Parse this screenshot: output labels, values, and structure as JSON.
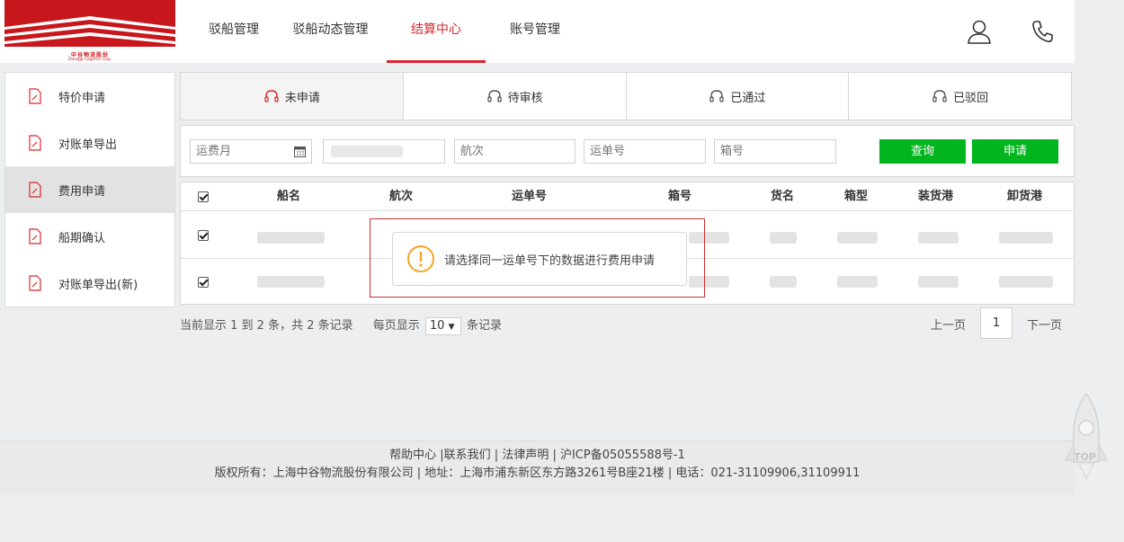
{
  "logo": {
    "text": "中谷物流股份",
    "sub": "Zhonggu Logistics Corp."
  },
  "nav": {
    "items": [
      "驳船管理",
      "驳船动态管理",
      "结算中心",
      "账号管理"
    ],
    "active_index": 2
  },
  "header_icons": [
    "user-icon",
    "phone-icon"
  ],
  "sidebar": {
    "items": [
      "特价申请",
      "对账单导出",
      "费用申请",
      "船期确认",
      "对账单导出(新)"
    ],
    "active_index": 2
  },
  "tabs": {
    "items": [
      "未申请",
      "待审核",
      "已通过",
      "已驳回"
    ],
    "active_index": 0
  },
  "filter": {
    "freight_month_placeholder": "运费月",
    "voyage_placeholder": "航次",
    "waybill_placeholder": "运单号",
    "box_placeholder": "箱号",
    "query_label": "查询",
    "apply_label": "申请"
  },
  "table": {
    "headers": [
      "船名",
      "航次",
      "运单号",
      "箱号",
      "货名",
      "箱型",
      "装货港",
      "卸货港"
    ],
    "rows": [
      {
        "checked": true
      },
      {
        "checked": true
      }
    ]
  },
  "toast": {
    "message": "请选择同一运单号下的数据进行费用申请"
  },
  "pagination": {
    "info": "当前显示 1 到 2 条，共 2 条记录",
    "per_page_prefix": "每页显示",
    "per_page_value": "10",
    "per_page_suffix": "条记录",
    "prev": "上一页",
    "current": "1",
    "next": "下一页"
  },
  "footer": {
    "line1": "帮助中心 |联系我们 | 法律声明 | 沪ICP备05055588号-1",
    "line2": "版权所有：上海中谷物流股份有限公司 | 地址：上海市浦东新区东方路3261号B座21楼 | 电话：021-31109906,31109911"
  },
  "back_to_top": {
    "label": "TOP"
  },
  "colors": {
    "accent": "#d7282e",
    "button": "#00b51d",
    "warning": "#f5a623"
  }
}
